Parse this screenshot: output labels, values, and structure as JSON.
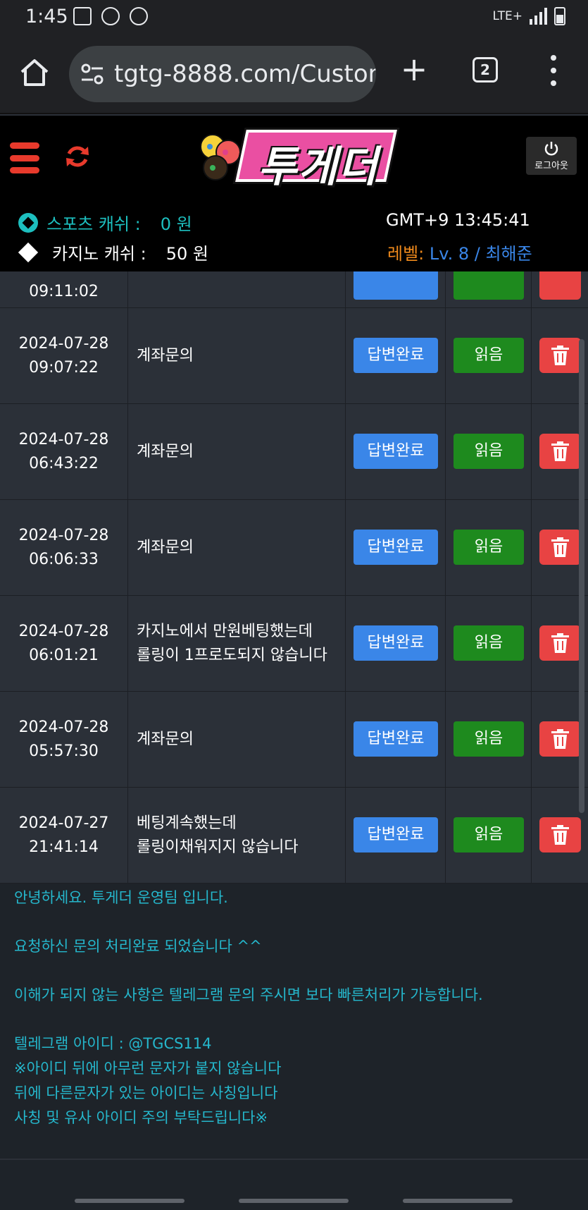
{
  "status_bar": {
    "time": "1:45",
    "network": "LTE+"
  },
  "browser": {
    "url": "tgtg-8888.com/Custon",
    "tab_count": "2"
  },
  "site": {
    "logo_text": "투게더",
    "logout_label": "로그아웃",
    "sports_cash_label": "스포츠 캐쉬 :",
    "sports_cash_value": "0 원",
    "casino_cash_label": "카지노 캐쉬 :",
    "casino_cash_value": "50 원",
    "clock": "GMT+9 13:45:41",
    "level_label": "레벨:",
    "level_value": "Lv. 8 / 최해준"
  },
  "table": {
    "partial_row": {
      "time": "09:11:02"
    },
    "rows": [
      {
        "date": "2024-07-28",
        "time": "09:07:22",
        "title_line1": "계좌문의",
        "title_line2": "",
        "status": "답변완료",
        "read": "읽음"
      },
      {
        "date": "2024-07-28",
        "time": "06:43:22",
        "title_line1": "계좌문의",
        "title_line2": "",
        "status": "답변완료",
        "read": "읽음"
      },
      {
        "date": "2024-07-28",
        "time": "06:06:33",
        "title_line1": "계좌문의",
        "title_line2": "",
        "status": "답변완료",
        "read": "읽음"
      },
      {
        "date": "2024-07-28",
        "time": "06:01:21",
        "title_line1": "카지노에서 만원베팅했는데",
        "title_line2": "롤링이 1프로도되지 않습니다",
        "status": "답변완료",
        "read": "읽음"
      },
      {
        "date": "2024-07-28",
        "time": "05:57:30",
        "title_line1": "계좌문의",
        "title_line2": "",
        "status": "답변완료",
        "read": "읽음"
      },
      {
        "date": "2024-07-27",
        "time": "21:41:14",
        "title_line1": "베팅계속했는데",
        "title_line2": "롤링이채워지지 않습니다",
        "status": "답변완료",
        "read": "읽음"
      }
    ]
  },
  "notice": {
    "line1": "안녕하세요. 투게더 운영팀 입니다.",
    "line2": "요청하신 문의 처리완료 되었습니다 ^^",
    "line3": "이해가 되지 않는 사항은 텔레그램 문의 주시면 보다 빠른처리가 가능합니다.",
    "line4": "텔레그램 아이디 : @TGCS114",
    "line5": "※아이디 뒤에 아무런 문자가 붙지 않습니다",
    "line6": "뒤에 다른문자가 있는 아이디는 사칭입니다",
    "line7": "사칭 및 유사 아이디 주의 부탁드립니다※"
  },
  "colors": {
    "status_button": "#3a86e8",
    "read_button": "#1e8a1e",
    "delete_button": "#e84343",
    "notice_text": "#25b7cc",
    "sports_cash": "#1dbfbf",
    "level_label": "#f08a1c"
  }
}
